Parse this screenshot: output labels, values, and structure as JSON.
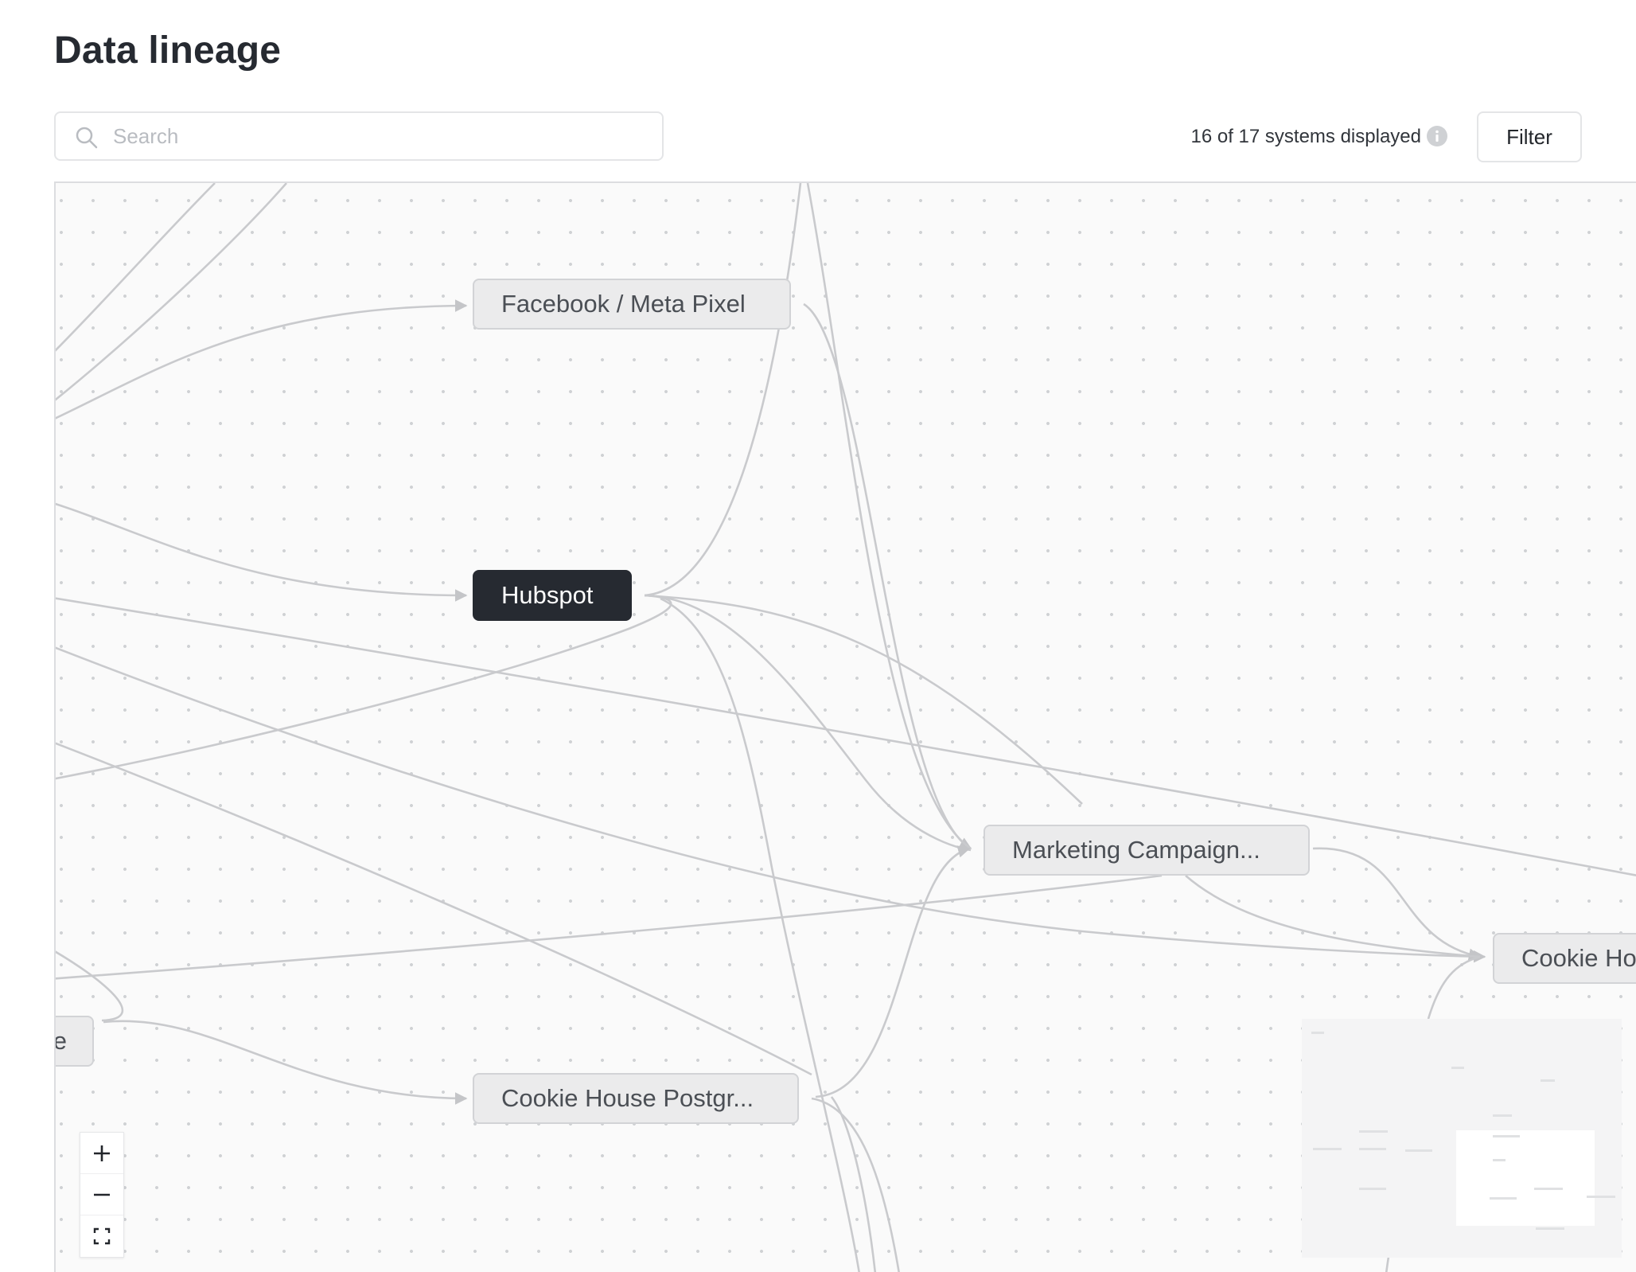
{
  "page": {
    "title": "Data lineage"
  },
  "search": {
    "placeholder": "Search",
    "value": ""
  },
  "systems": {
    "count_text": "16 of 17 systems displayed"
  },
  "toolbar": {
    "filter_label": "Filter"
  },
  "graph": {
    "nodes": {
      "facebook": "Facebook / Meta Pixel",
      "hubspot": "Hubspot",
      "marketing": "Marketing Campaign...",
      "cookie_postgres": "Cookie House Postgr...",
      "cookie_right": "Cookie House",
      "left_partial": "e"
    },
    "selected_node": "hubspot"
  },
  "colors": {
    "edge": "#c7c8cb",
    "node_bg": "#ebebec",
    "node_border": "#d2d3d6",
    "selected_bg": "#262a31",
    "selected_text": "#ffffff",
    "canvas_bg": "#fafafa"
  },
  "icons": {
    "search": "search-icon",
    "info": "info-icon",
    "zoom_in": "plus-icon",
    "zoom_out": "minus-icon",
    "fit": "fit-view-icon"
  }
}
